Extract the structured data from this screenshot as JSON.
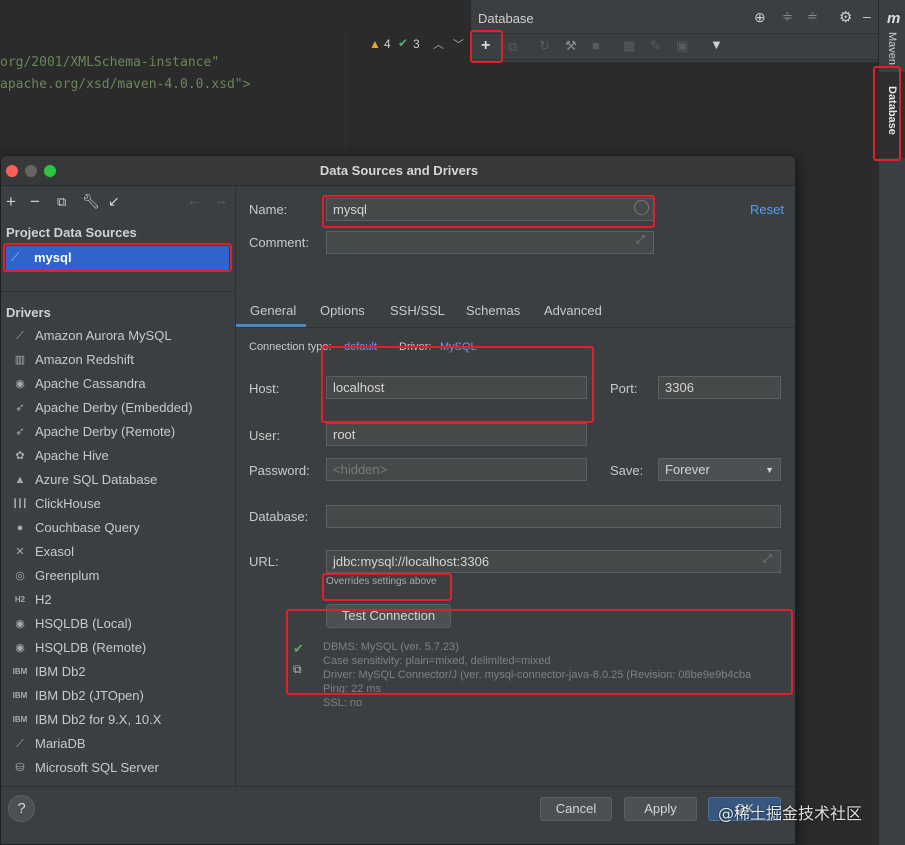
{
  "editor": {
    "code_line_1": "org/2001/XMLSchema-instance\"",
    "code_line_2": "apache.org/xsd/maven-4.0.0.xsd\">",
    "warnings_count": "4",
    "checks_count": "3"
  },
  "db_panel": {
    "title": "Database"
  },
  "right_strip": {
    "maven_label": "Maven",
    "database_label": "Database",
    "maven_glyph": "m"
  },
  "dialog": {
    "title": "Data Sources and Drivers",
    "sidebar": {
      "project_section": "Project Data Sources",
      "selected_source": "mysql",
      "drivers_section": "Drivers",
      "drivers": [
        {
          "label": "Amazon Aurora MySQL",
          "icon": "aurora-icon"
        },
        {
          "label": "Amazon Redshift",
          "icon": "redshift-icon"
        },
        {
          "label": "Apache Cassandra",
          "icon": "cassandra-icon"
        },
        {
          "label": "Apache Derby (Embedded)",
          "icon": "derby-icon"
        },
        {
          "label": "Apache Derby (Remote)",
          "icon": "derby-icon"
        },
        {
          "label": "Apache Hive",
          "icon": "hive-icon"
        },
        {
          "label": "Azure SQL Database",
          "icon": "azure-icon"
        },
        {
          "label": "ClickHouse",
          "icon": "clickhouse-icon"
        },
        {
          "label": "Couchbase Query",
          "icon": "couchbase-icon"
        },
        {
          "label": "Exasol",
          "icon": "exasol-icon"
        },
        {
          "label": "Greenplum",
          "icon": "greenplum-icon"
        },
        {
          "label": "H2",
          "icon": "h2-icon"
        },
        {
          "label": "HSQLDB (Local)",
          "icon": "hsqldb-icon"
        },
        {
          "label": "HSQLDB (Remote)",
          "icon": "hsqldb-icon"
        },
        {
          "label": "IBM Db2",
          "icon": "ibm-icon"
        },
        {
          "label": "IBM Db2 (JTOpen)",
          "icon": "ibm-icon"
        },
        {
          "label": "IBM Db2 for 9.X, 10.X",
          "icon": "ibm-icon"
        },
        {
          "label": "MariaDB",
          "icon": "mariadb-icon"
        },
        {
          "label": "Microsoft SQL Server",
          "icon": "mssql-icon"
        }
      ]
    },
    "form": {
      "name_label": "Name:",
      "name_value": "mysql",
      "reset": "Reset",
      "comment_label": "Comment:",
      "comment_value": "",
      "tabs": [
        "General",
        "Options",
        "SSH/SSL",
        "Schemas",
        "Advanced"
      ],
      "active_tab": "General",
      "connection_type_label": "Connection type:",
      "connection_type_value": "default",
      "driver_label": "Driver:",
      "driver_value": "MySQL",
      "host_label": "Host:",
      "host_value": "localhost",
      "port_label": "Port:",
      "port_value": "3306",
      "user_label": "User:",
      "user_value": "root",
      "password_label": "Password:",
      "password_placeholder": "<hidden>",
      "save_label": "Save:",
      "save_value": "Forever",
      "database_label": "Database:",
      "database_value": "",
      "url_label": "URL:",
      "url_value": "jdbc:mysql://localhost:3306",
      "url_hint": "Overrides settings above",
      "test_connection": "Test Connection",
      "result": {
        "dbms": "DBMS: MySQL (ver. 5.7.23)",
        "case": "Case sensitivity: plain=mixed, delimited=mixed",
        "driver": "Driver: MySQL Connector/J (ver. mysql-connector-java-8.0.25 (Revision: 08be9e9b4cba",
        "ping": "Ping: 22 ms",
        "ssl": "SSL: no"
      }
    },
    "footer": {
      "help": "?",
      "cancel": "Cancel",
      "apply": "Apply",
      "ok": "OK"
    }
  },
  "watermark": "@稀土掘金技术社区",
  "colors": {
    "accent_red": "#e0202a",
    "selection": "#2f65ca",
    "link": "#589df6",
    "check": "#59a869"
  }
}
